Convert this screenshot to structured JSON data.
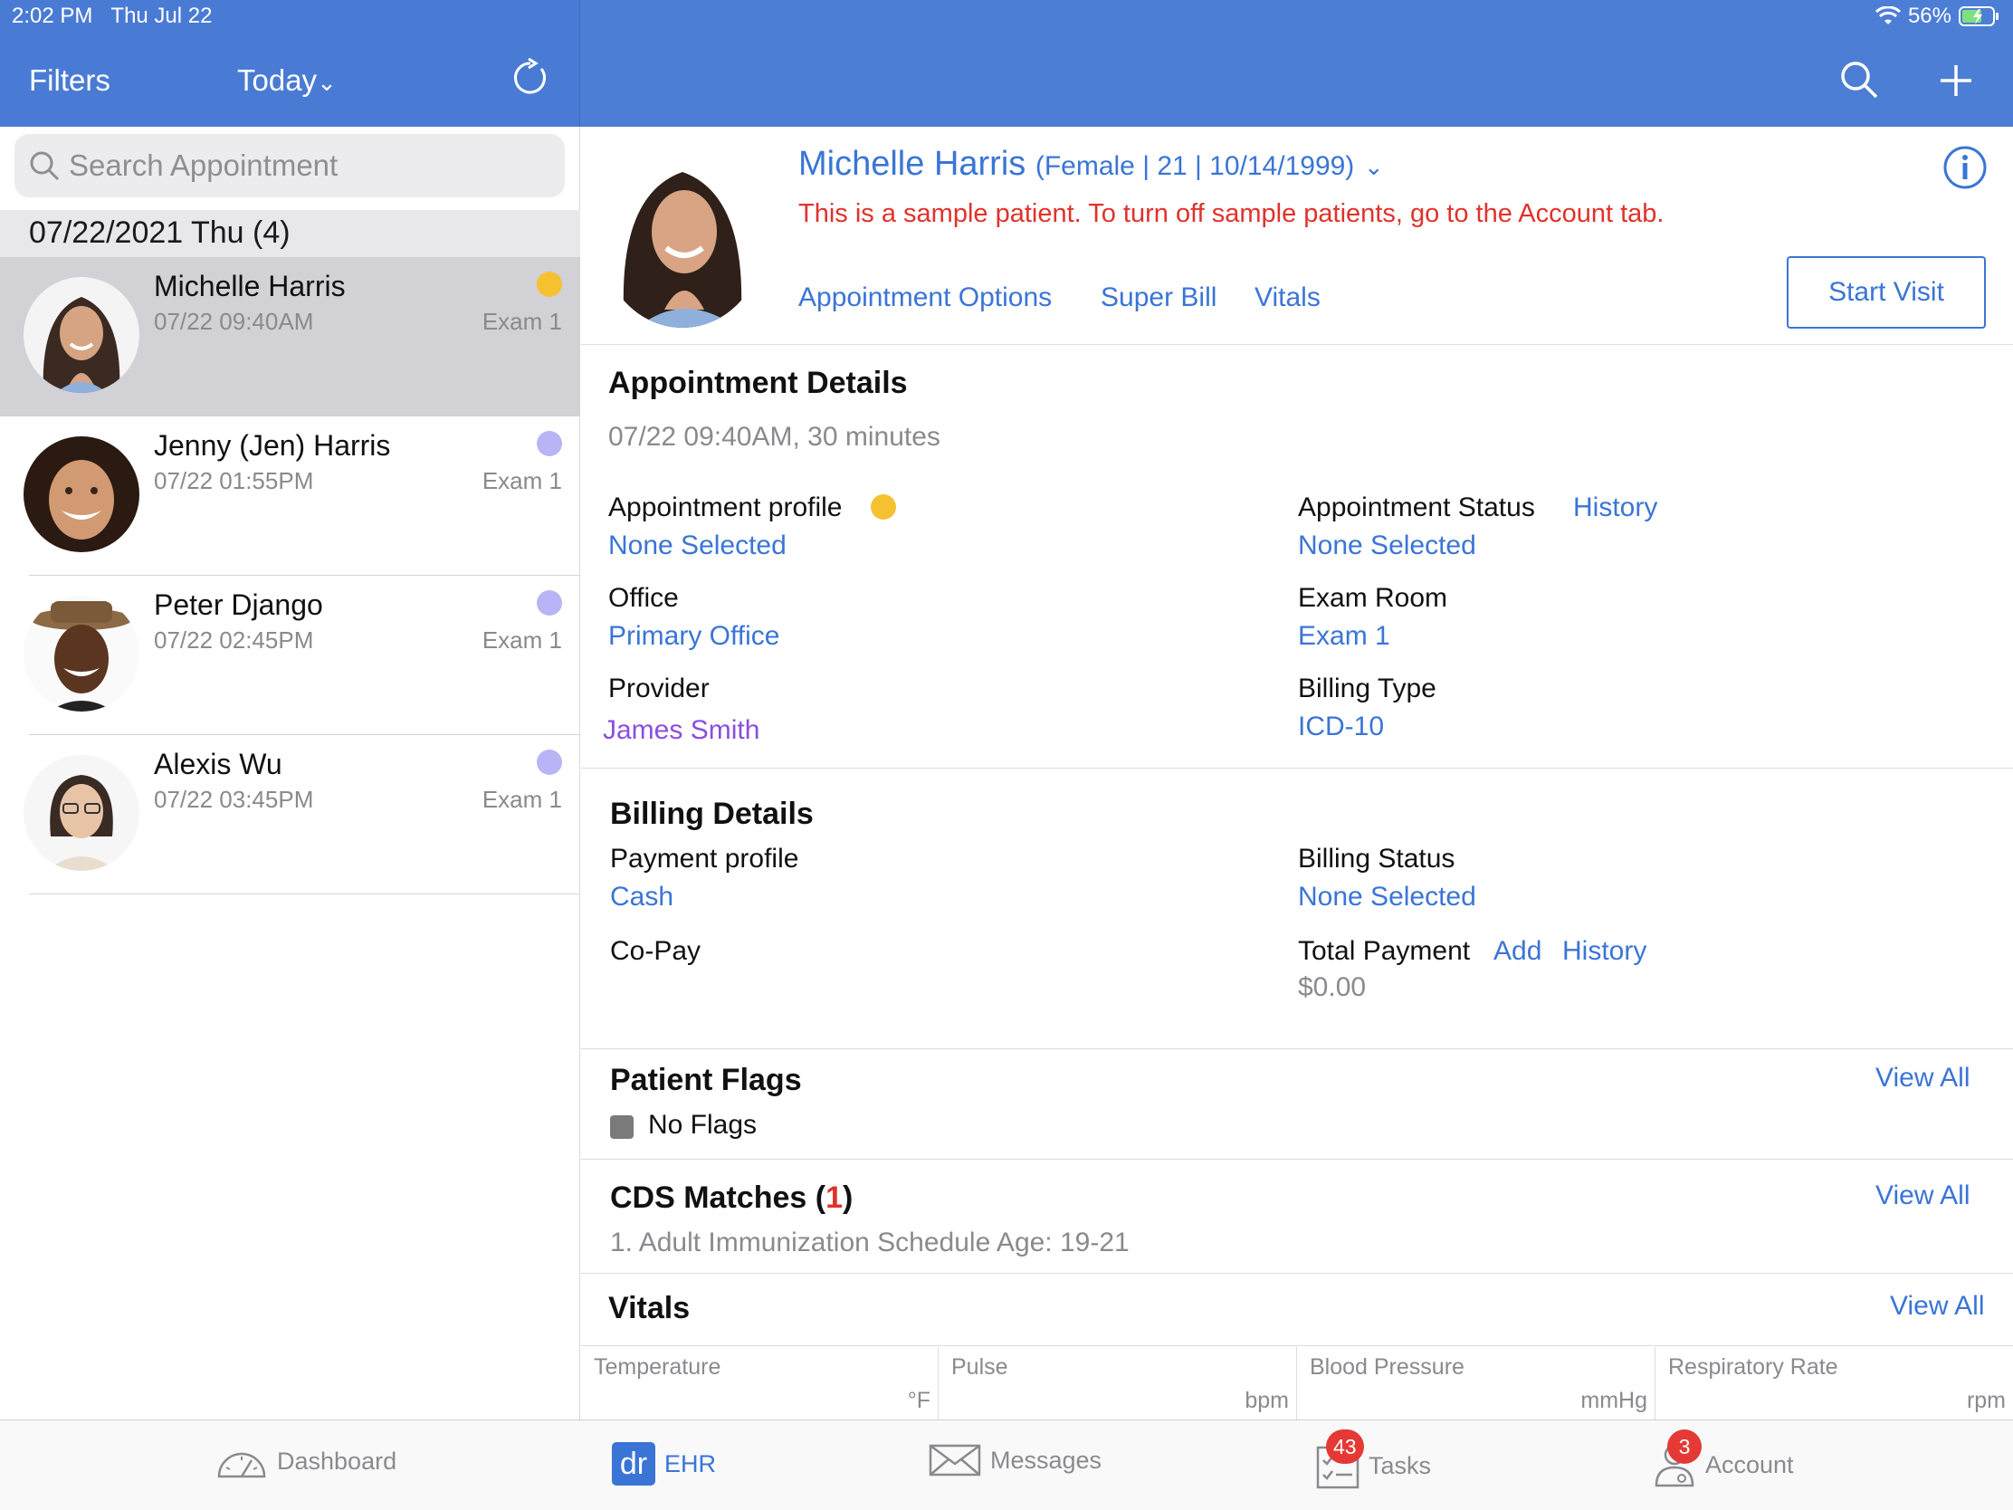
{
  "status_bar": {
    "time": "2:02 PM",
    "date": "Thu Jul 22",
    "battery": "56%"
  },
  "header": {
    "filters": "Filters",
    "range": "Today",
    "range_chevron": "⌄"
  },
  "search": {
    "placeholder": "Search Appointment"
  },
  "list": {
    "date_header": "07/22/2021 Thu (4)",
    "items": [
      {
        "name": "Michelle Harris",
        "time": "07/22 09:40AM",
        "room": "Exam 1",
        "dot_color": "#f6c131"
      },
      {
        "name": "Jenny (Jen) Harris",
        "time": "07/22 01:55PM",
        "room": "Exam 1",
        "dot_color": "#b9b4f5"
      },
      {
        "name": "Peter Django",
        "time": "07/22 02:45PM",
        "room": "Exam 1",
        "dot_color": "#b9b4f5"
      },
      {
        "name": "Alexis Wu",
        "time": "07/22 03:45PM",
        "room": "Exam 1",
        "dot_color": "#b9b4f5"
      }
    ]
  },
  "patient": {
    "name": "Michelle Harris",
    "info": "(Female | 21 | 10/14/1999)",
    "sample_notice": "This is a sample patient. To turn off sample patients, go to the Account tab.",
    "links": [
      "Appointment Options",
      "Super Bill",
      "Vitals"
    ],
    "start_visit": "Start Visit"
  },
  "appointment_details": {
    "title": "Appointment Details",
    "summary": "07/22 09:40AM, 30 minutes",
    "profile_label": "Appointment profile",
    "profile_value": "None Selected",
    "status_label": "Appointment Status",
    "status_history": "History",
    "status_value": "None Selected",
    "office_label": "Office",
    "office_value": "Primary Office",
    "room_label": "Exam Room",
    "room_value": "Exam 1",
    "provider_label": "Provider",
    "provider_value": "James Smith",
    "billing_type_label": "Billing Type",
    "billing_type_value": "ICD-10"
  },
  "billing_details": {
    "title": "Billing Details",
    "payment_profile_label": "Payment profile",
    "payment_profile_value": "Cash",
    "billing_status_label": "Billing Status",
    "billing_status_value": "None Selected",
    "copay_label": "Co-Pay",
    "total_label": "Total Payment",
    "total_add": "Add",
    "total_history": "History",
    "total_value": "$0.00"
  },
  "patient_flags": {
    "title": "Patient Flags",
    "view_all": "View All",
    "none": "No Flags"
  },
  "cds": {
    "title_prefix": "CDS Matches (",
    "count": "1",
    "title_suffix": ")",
    "view_all": "View All",
    "item": "1. Adult Immunization Schedule Age: 19-21"
  },
  "vitals": {
    "title": "Vitals",
    "view_all": "View All",
    "cells": [
      {
        "label": "Temperature",
        "unit": "°F"
      },
      {
        "label": "Pulse",
        "unit": "bpm"
      },
      {
        "label": "Blood Pressure",
        "unit": "mmHg"
      },
      {
        "label": "Respiratory Rate",
        "unit": "rpm"
      }
    ]
  },
  "tabbar": {
    "dashboard": "Dashboard",
    "ehr": "EHR",
    "ehr_logo": "dr",
    "messages": "Messages",
    "tasks": "Tasks",
    "tasks_badge": "43",
    "account": "Account",
    "account_badge": "3"
  },
  "colors": {
    "header": "#4d7ed6",
    "link": "#3a75d6",
    "alert": "#e0322b",
    "provider": "#8a4ee0"
  }
}
